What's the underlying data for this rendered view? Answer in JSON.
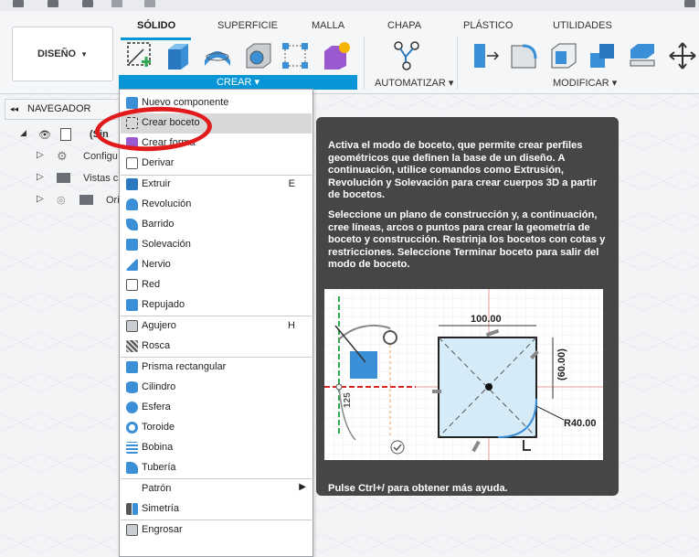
{
  "ribbon": {
    "workspace_button": "DISEÑO",
    "tabs": [
      "SÓLIDO",
      "SUPERFICIE",
      "MALLA",
      "CHAPA",
      "PLÁSTICO",
      "UTILIDADES"
    ],
    "groups": {
      "crear": "CREAR",
      "automatizar": "AUTOMATIZAR",
      "modificar": "MODIFICAR"
    }
  },
  "navigator": {
    "title": "NAVEGADOR",
    "root": "(Sin",
    "items": [
      "Configu",
      "Vistas c",
      "Ori"
    ]
  },
  "menu": {
    "items": [
      {
        "label": "Nuevo componente",
        "shortcut": ""
      },
      {
        "label": "Crear boceto",
        "shortcut": ""
      },
      {
        "label": "Crear forma",
        "shortcut": ""
      },
      {
        "label": "Derivar",
        "shortcut": ""
      },
      {
        "label": "Extruir",
        "shortcut": "E"
      },
      {
        "label": "Revolución",
        "shortcut": ""
      },
      {
        "label": "Barrido",
        "shortcut": ""
      },
      {
        "label": "Solevación",
        "shortcut": ""
      },
      {
        "label": "Nervio",
        "shortcut": ""
      },
      {
        "label": "Red",
        "shortcut": ""
      },
      {
        "label": "Repujado",
        "shortcut": ""
      },
      {
        "label": "Agujero",
        "shortcut": "H"
      },
      {
        "label": "Rosca",
        "shortcut": ""
      },
      {
        "label": "Prisma rectangular",
        "shortcut": ""
      },
      {
        "label": "Cilindro",
        "shortcut": ""
      },
      {
        "label": "Esfera",
        "shortcut": ""
      },
      {
        "label": "Toroide",
        "shortcut": ""
      },
      {
        "label": "Bobina",
        "shortcut": ""
      },
      {
        "label": "Tubería",
        "shortcut": ""
      },
      {
        "label": "Patrón",
        "shortcut": ""
      },
      {
        "label": "Simetría",
        "shortcut": ""
      },
      {
        "label": "Engrosar",
        "shortcut": ""
      }
    ]
  },
  "tooltip": {
    "para1": "Activa el modo de boceto, que permite crear perfiles geométricos que definen la base de un diseño. A continuación, utilice comandos como Extrusión, Revolución y Solevación para crear cuerpos 3D a partir de bocetos.",
    "para2": "Seleccione un plano de construcción y, a continuación, cree líneas, arcos o puntos para crear la geometría de boceto y construcción. Restrinja los bocetos con cotas y restricciones. Seleccione Terminar boceto para salir del modo de boceto.",
    "footer": "Pulse Ctrl+/ para obtener más ayuda.",
    "image": {
      "dim_width": "100.00",
      "dim_height": "(60.00)",
      "dim_radius": "R40.00",
      "dim_angle": "125"
    }
  },
  "colors": {
    "accent": "#0696d7",
    "tooltip_bg": "#464646",
    "annotation": "#e11b1b"
  }
}
